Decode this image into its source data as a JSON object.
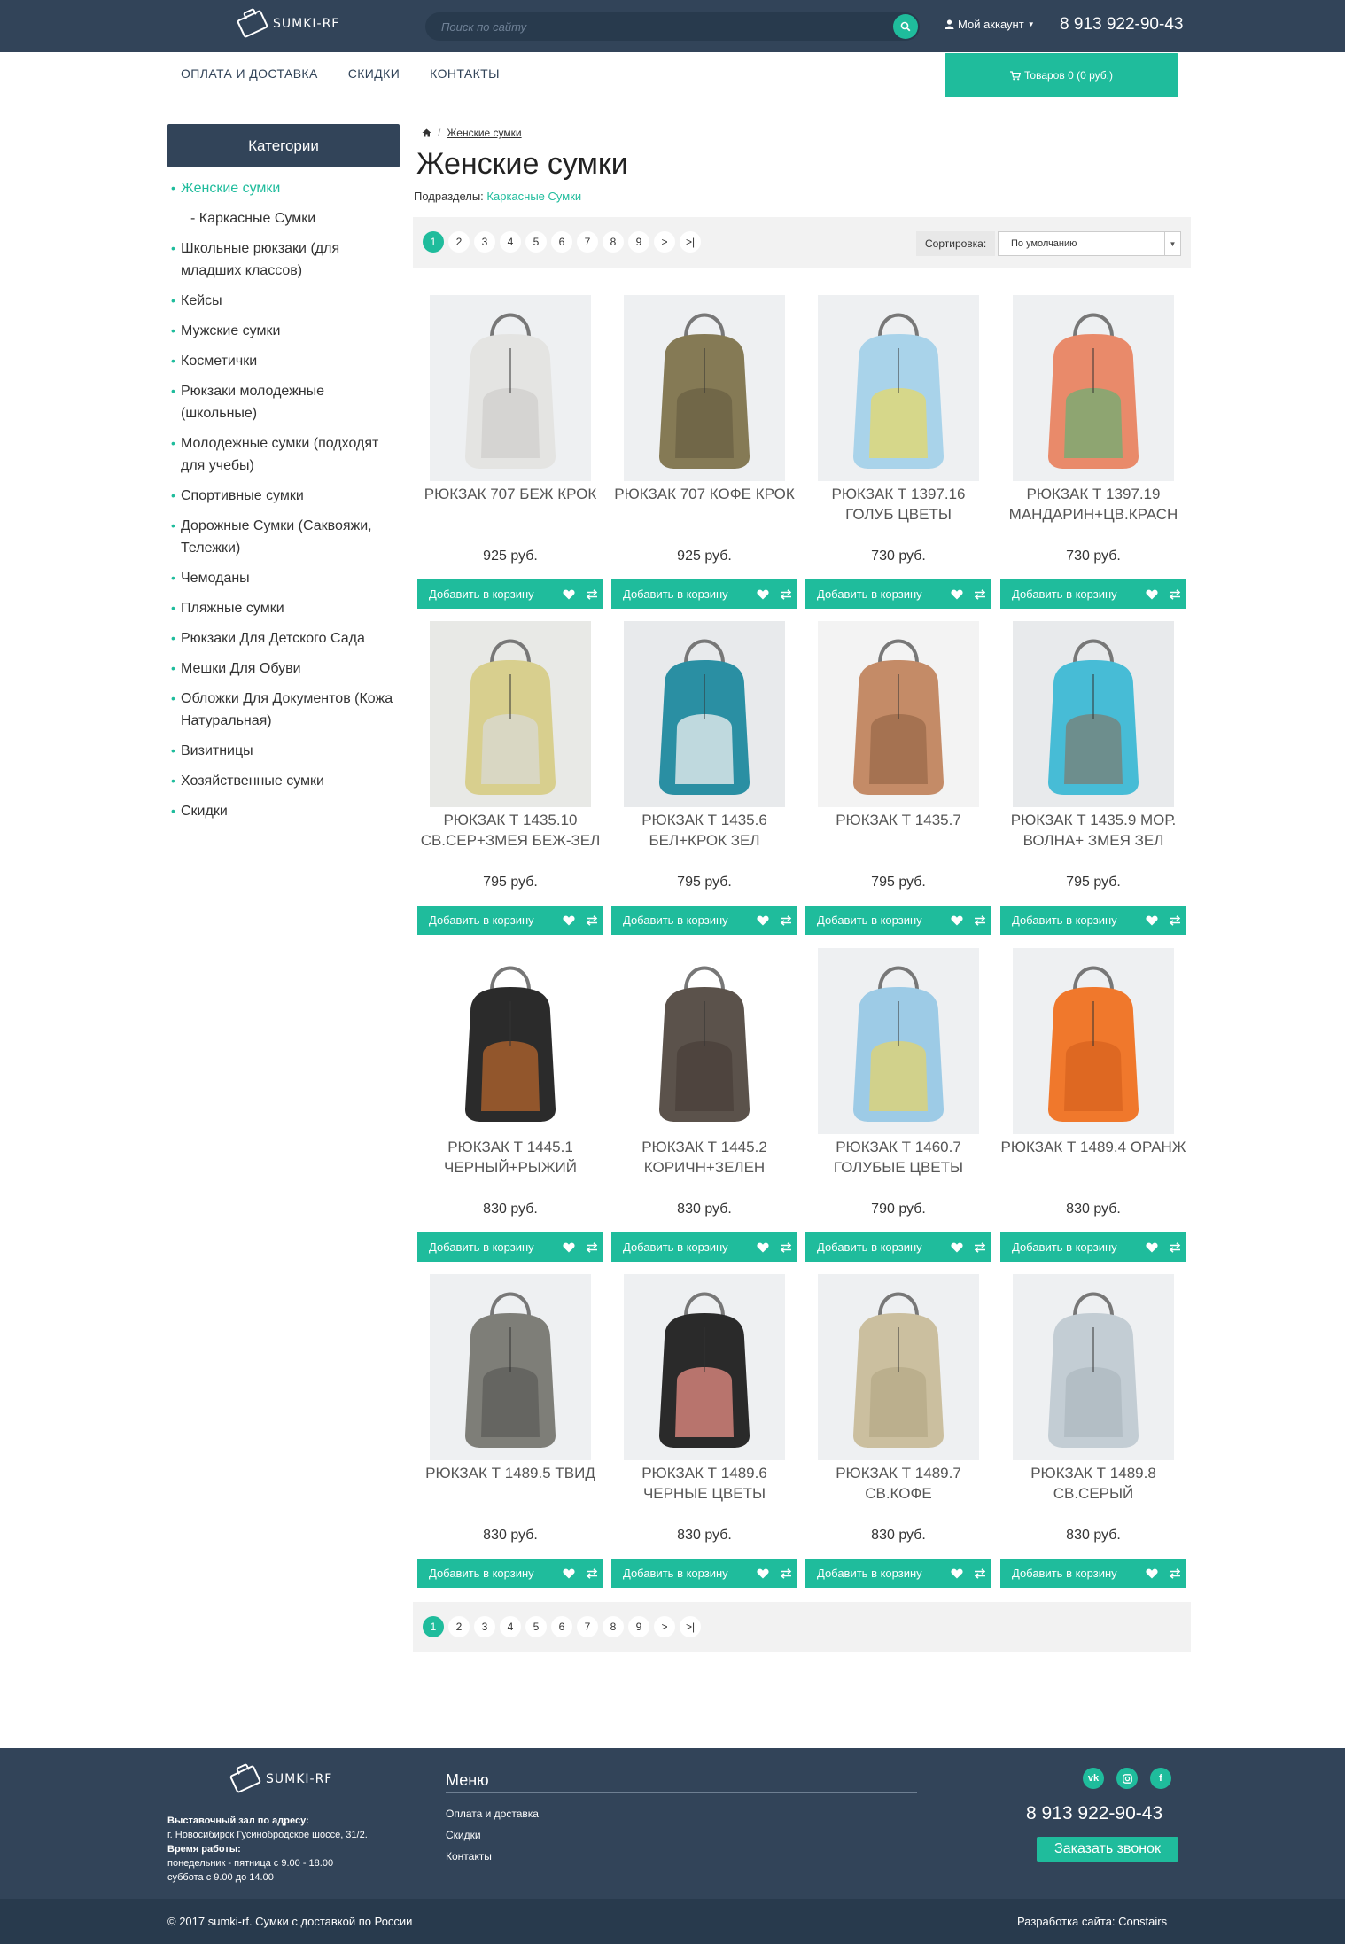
{
  "header": {
    "logo_text": "SUMKI-RF",
    "search_placeholder": "Поиск по сайту",
    "account_label": "Мой аккаунт",
    "phone": "8 913 922-90-43"
  },
  "nav": {
    "items": [
      "ОПЛАТА И ДОСТАВКА",
      "СКИДКИ",
      "КОНТАКТЫ"
    ],
    "cart_label": "Товаров 0 (0 руб.)"
  },
  "sidebar": {
    "title": "Категории",
    "items": [
      {
        "label": "Женские сумки",
        "active": true,
        "sub": false
      },
      {
        "label": "- Каркасные Сумки",
        "active": false,
        "sub": true
      },
      {
        "label": "Школьные рюкзаки (для младших классов)",
        "active": false,
        "sub": false
      },
      {
        "label": "Кейсы",
        "active": false,
        "sub": false
      },
      {
        "label": "Мужские сумки",
        "active": false,
        "sub": false
      },
      {
        "label": "Косметички",
        "active": false,
        "sub": false
      },
      {
        "label": "Рюкзаки молодежные (школьные)",
        "active": false,
        "sub": false
      },
      {
        "label": "Молодежные сумки (подходят для учебы)",
        "active": false,
        "sub": false
      },
      {
        "label": "Спортивные сумки",
        "active": false,
        "sub": false
      },
      {
        "label": "Дорожные Сумки (Саквояжи, Тележки)",
        "active": false,
        "sub": false
      },
      {
        "label": "Чемоданы",
        "active": false,
        "sub": false
      },
      {
        "label": "Пляжные сумки",
        "active": false,
        "sub": false
      },
      {
        "label": "Рюкзаки Для Детского Сада",
        "active": false,
        "sub": false
      },
      {
        "label": "Мешки Для Обуви",
        "active": false,
        "sub": false
      },
      {
        "label": "Обложки Для Документов (Кожа Натуральная)",
        "active": false,
        "sub": false
      },
      {
        "label": "Визитницы",
        "active": false,
        "sub": false
      },
      {
        "label": "Хозяйственные сумки",
        "active": false,
        "sub": false
      },
      {
        "label": "Скидки",
        "active": false,
        "sub": false
      }
    ]
  },
  "main": {
    "breadcrumb_current": "Женские сумки",
    "title": "Женские сумки",
    "subsections_label": "Подразделы:",
    "subsections_link": "Каркасные Сумки",
    "pages": [
      "1",
      "2",
      "3",
      "4",
      "5",
      "6",
      "7",
      "8",
      "9",
      ">",
      ">|"
    ],
    "sort_label": "Сортировка:",
    "sort_value": "По умолчанию",
    "add_to_cart": "Добавить в корзину",
    "products": [
      {
        "name": "РЮКЗАК 707 БЕЖ КРОК",
        "price": "925 руб.",
        "color": "#e4e4e2",
        "accent": "#d0cfcc",
        "bg": "#eef0f2"
      },
      {
        "name": "РЮКЗАК 707 КОФЕ КРОК",
        "price": "925 руб.",
        "color": "#857a55",
        "accent": "#6b6244",
        "bg": "#eef0f2"
      },
      {
        "name": "РЮКЗАК Т 1397.16 ГОЛУБ ЦВЕТЫ",
        "price": "730 руб.",
        "color": "#a9d3ea",
        "accent": "#e6d86a",
        "bg": "#eef0f2"
      },
      {
        "name": "РЮКЗАК Т 1397.19 МАНДАРИН+ЦВ.КРАСН",
        "price": "730 руб.",
        "color": "#e98a6a",
        "accent": "#6fae74",
        "bg": "#eef0f2"
      },
      {
        "name": "РЮКЗАК Т 1435.10 СВ.СЕР+ЗМЕЯ БЕЖ-ЗЕЛ",
        "price": "795 руб.",
        "color": "#d8cf8e",
        "accent": "#d9dad4",
        "bg": "#e8e9e6"
      },
      {
        "name": "РЮКЗАК Т 1435.6 БЕЛ+КРОК ЗЕЛ",
        "price": "795 руб.",
        "color": "#2a8fa3",
        "accent": "#f2f2f2",
        "bg": "#e8eaec"
      },
      {
        "name": "РЮКЗАК Т 1435.7",
        "price": "795 руб.",
        "color": "#c48b67",
        "accent": "#9b6a4a",
        "bg": "#f3f3f3"
      },
      {
        "name": "РЮКЗАК Т 1435.9 МОР. ВОЛНА+ ЗМЕЯ ЗЕЛ",
        "price": "795 руб.",
        "color": "#47bcd6",
        "accent": "#7a7f74",
        "bg": "#e8eaec"
      },
      {
        "name": "РЮКЗАК Т 1445.1 ЧЕРНЫЙ+РЫЖИЙ",
        "price": "830 руб.",
        "color": "#2b2b2b",
        "accent": "#b5652e",
        "bg": "#ffffff"
      },
      {
        "name": "РЮКЗАК Т 1445.2 КОРИЧН+ЗЕЛЕН",
        "price": "830 руб.",
        "color": "#5b524b",
        "accent": "#4a4039",
        "bg": "#ffffff"
      },
      {
        "name": "РЮКЗАК Т 1460.7 ГОЛУБЫЕ ЦВЕТЫ",
        "price": "790 руб.",
        "color": "#9dcbe6",
        "accent": "#e3d36c",
        "bg": "#eef0f2"
      },
      {
        "name": "РЮКЗАК Т 1489.4 ОРАНЖ",
        "price": "830 руб.",
        "color": "#f0782c",
        "accent": "#d8631f",
        "bg": "#eef0f2"
      },
      {
        "name": "РЮКЗАК Т 1489.5 ТВИД",
        "price": "830 руб.",
        "color": "#7e7e78",
        "accent": "#5e5e5a",
        "bg": "#eef0f2"
      },
      {
        "name": "РЮКЗАК Т 1489.6 ЧЕРНЫЕ ЦВЕТЫ",
        "price": "830 руб.",
        "color": "#2a2a2a",
        "accent": "#e88d84",
        "bg": "#eef0f2"
      },
      {
        "name": "РЮКЗАК Т 1489.7 СВ.КОФЕ",
        "price": "830 руб.",
        "color": "#cbbf9f",
        "accent": "#b5a987",
        "bg": "#eef0f2"
      },
      {
        "name": "РЮКЗАК Т 1489.8 СВ.СЕРЫЙ",
        "price": "830 руб.",
        "color": "#c3cdd4",
        "accent": "#aeb8c0",
        "bg": "#eef0f2"
      }
    ]
  },
  "footer": {
    "logo_text": "SUMKI-RF",
    "showroom_label": "Выставочный зал по адресу:",
    "address": "г. Новосибирск Гусинобродское шоссе, 31/2.",
    "hours_label": "Время работы:",
    "hours_weekday": "понедельник - пятница с 9.00 - 18.00",
    "hours_saturday": "суббота с 9.00 до 14.00",
    "menu_title": "Меню",
    "menu_links": [
      "Оплата и доставка",
      "Скидки",
      "Контакты"
    ],
    "social": [
      "vk",
      "ig",
      "f"
    ],
    "phone": "8 913 922-90-43",
    "callback_label": "Заказать звонок",
    "copyright": "© 2017 sumki-rf. Сумки с доставкой по России",
    "developer": "Разработка сайта: Constairs"
  },
  "colors": {
    "accent": "#1fbc9c",
    "dark": "#324459"
  }
}
